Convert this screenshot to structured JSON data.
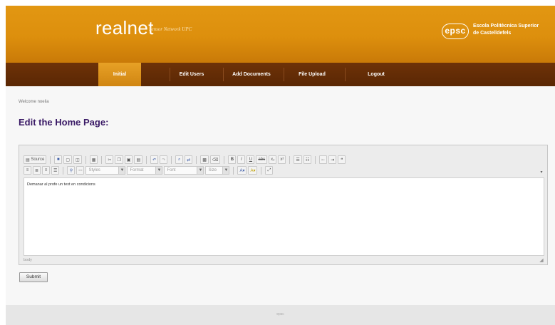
{
  "header": {
    "logo": "realnet",
    "logo_subtitle": "Sensor Network UPC",
    "school_badge": "epsc",
    "school_line1": "Escola Politècnica Superior",
    "school_line2": "de Castelldefels"
  },
  "nav": {
    "items": [
      {
        "label": "Initial",
        "active": true
      },
      {
        "label": "Edit Users",
        "active": false
      },
      {
        "label": "Add Documents",
        "active": false
      },
      {
        "label": "File Upload",
        "active": false
      },
      {
        "label": "Logout",
        "active": false
      }
    ]
  },
  "welcome_text": "Welcome noelia",
  "page_title": "Edit the Home Page:",
  "editor": {
    "toolbar_row1": [
      "Source",
      "save",
      "new-page",
      "preview",
      "templates",
      "cut",
      "copy",
      "paste",
      "paste-text",
      "paste-word",
      "undo",
      "redo",
      "find",
      "replace",
      "select-all",
      "remove-format",
      "B",
      "I",
      "U",
      "abc",
      "x₂",
      "x²",
      "numbered-list",
      "bulleted-list",
      "outdent",
      "indent",
      "quote"
    ],
    "toolbar_row2_combos": [
      "Styles",
      "Format",
      "Font",
      "Size"
    ],
    "content": "Demanar al profe un text en condicions",
    "status_path": "body",
    "accent_color": "#3a1a66"
  },
  "submit_label": "Submit",
  "footer_text": "epsc"
}
